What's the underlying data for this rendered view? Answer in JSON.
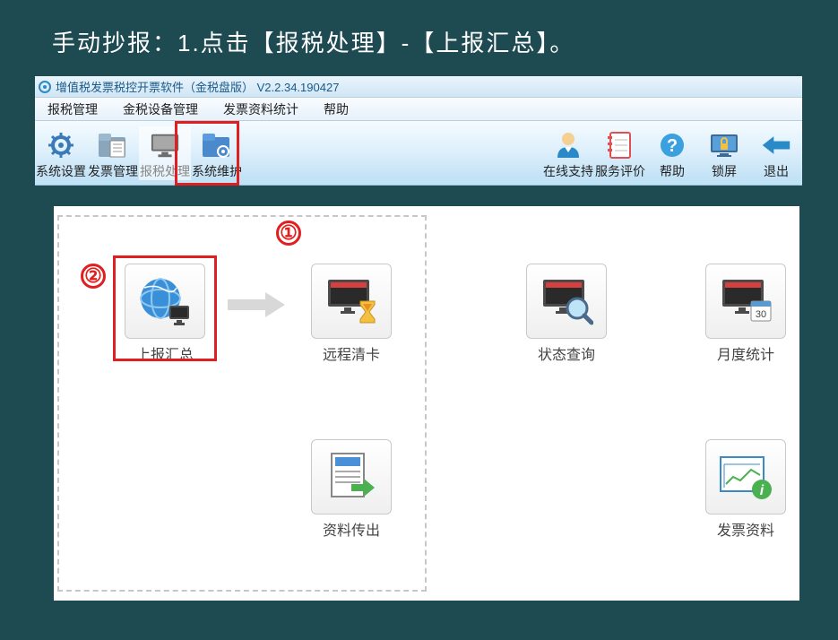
{
  "instruction": "手动抄报：1.点击【报税处理】-【上报汇总】。",
  "window": {
    "title": "增值税发票税控开票软件（金税盘版） V2.2.34.190427"
  },
  "menubar": {
    "items": [
      "报税管理",
      "金税设备管理",
      "发票资料统计",
      "帮助"
    ]
  },
  "toolbar": {
    "left": [
      {
        "label": "系统设置",
        "icon": "gear"
      },
      {
        "label": "发票管理",
        "icon": "folder-doc"
      },
      {
        "label": "报税处理",
        "icon": "monitor",
        "selected": true
      },
      {
        "label": "系统维护",
        "icon": "folder-gear"
      }
    ],
    "right": [
      {
        "label": "在线支持",
        "icon": "person"
      },
      {
        "label": "服务评价",
        "icon": "notebook"
      },
      {
        "label": "帮助",
        "icon": "question"
      },
      {
        "label": "锁屏",
        "icon": "lock-screen"
      },
      {
        "label": "退出",
        "icon": "back-arrow"
      }
    ]
  },
  "callouts": {
    "c1": "①",
    "c2": "②"
  },
  "tiles": {
    "upload_summary": "上报汇总",
    "remote_clear": "远程清卡",
    "status_query": "状态查询",
    "monthly_stats": "月度统计",
    "data_export": "资料传出",
    "invoice_data": "发票资料"
  }
}
